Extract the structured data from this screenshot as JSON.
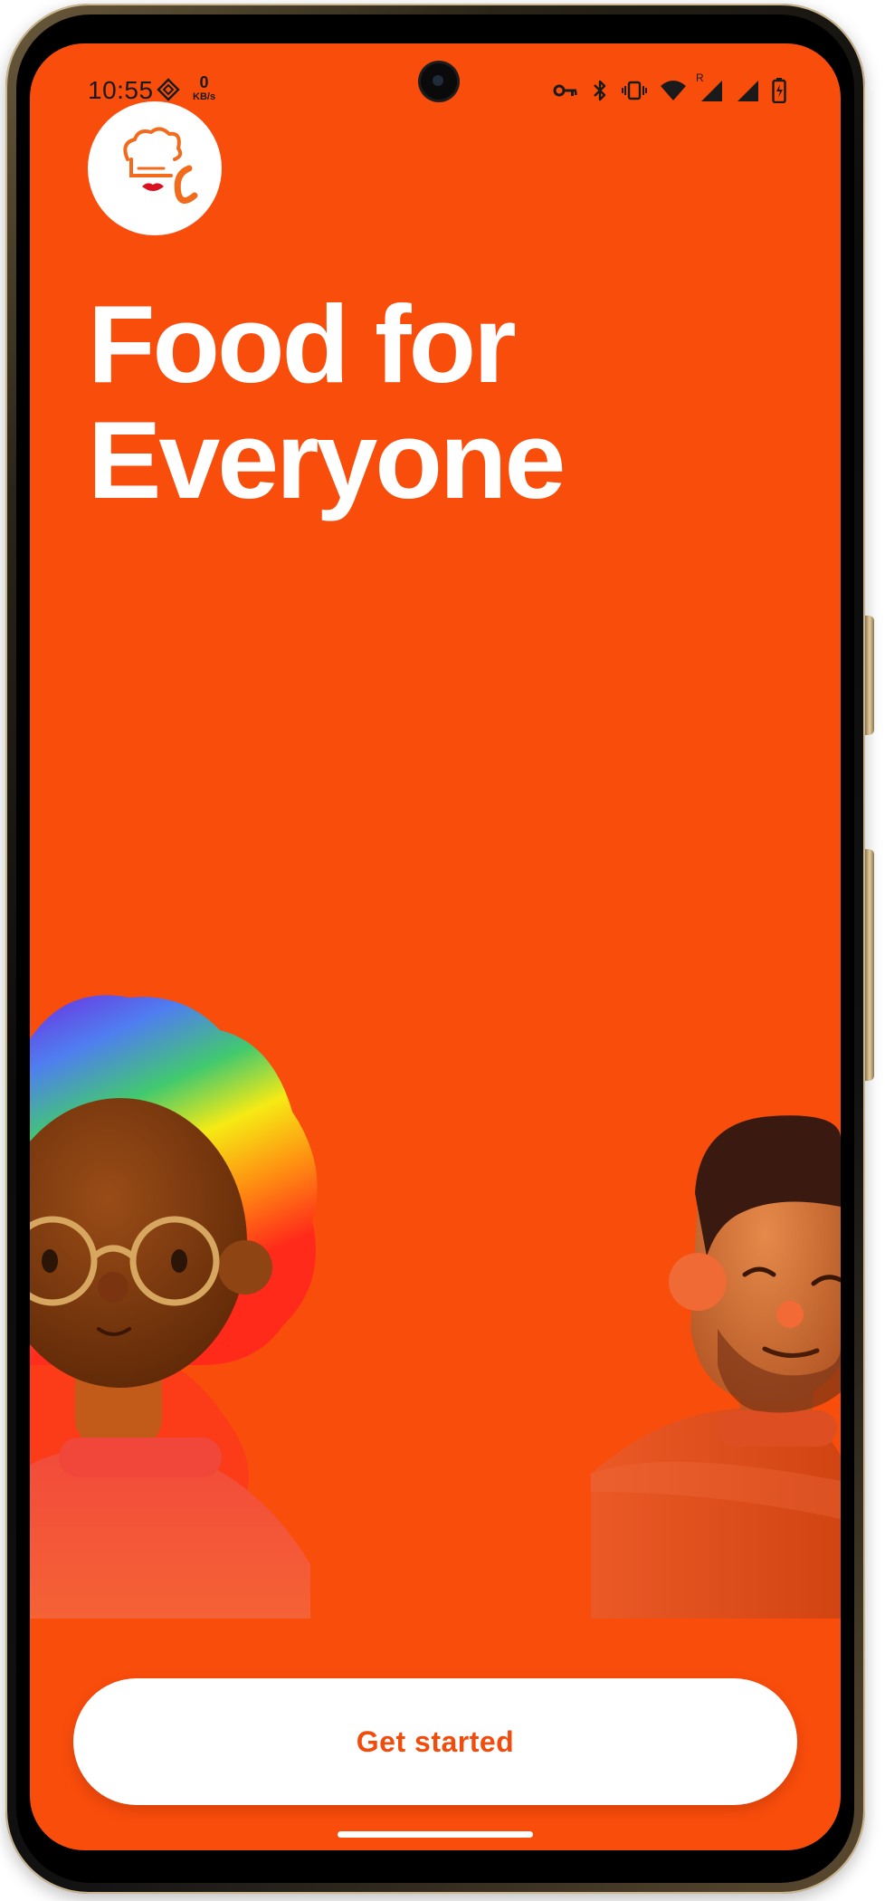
{
  "status_bar": {
    "time": "10:55",
    "network_speed_value": "0",
    "network_speed_unit": "KB/s",
    "icons": [
      "data-saver-icon",
      "vpn-key-icon",
      "bluetooth-icon",
      "vibrate-icon",
      "wifi-icon",
      "signal-roaming-icon",
      "signal-icon",
      "battery-icon"
    ],
    "roaming_label": "R"
  },
  "logo": {
    "icon": "chef-hat-logo-icon"
  },
  "headline": {
    "line1": "Food for",
    "line2": "Everyone"
  },
  "illustration": {
    "figures": [
      "woman-with-rainbow-hair-avatar",
      "bearded-man-avatar"
    ]
  },
  "cta": {
    "label": "Get started"
  },
  "colors": {
    "background": "#f94d0c",
    "button_text": "#f24c0d",
    "button_bg": "#ffffff",
    "headline": "#ffffff"
  }
}
